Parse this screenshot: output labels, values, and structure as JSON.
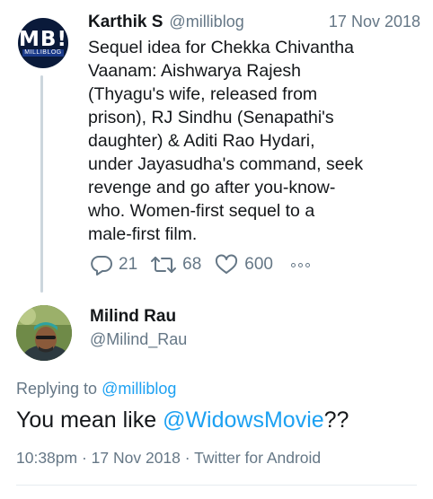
{
  "tweet1": {
    "avatar_text": "MB!",
    "avatar_subtext": "MILLIBLOG",
    "name": "Karthik S",
    "handle": "@milliblog",
    "date": "17 Nov 2018",
    "lines": [
      "Sequel idea for Chekka Chivantha",
      "Vaanam: Aishwarya Rajesh",
      "(Thyagu's wife, released from",
      "prison), RJ Sindhu (Senapathi's",
      "daughter) & Aditi Rao Hydari,",
      "under Jayasudha's command, seek",
      "revenge and go after you-know-",
      "who. Women-first sequel to a",
      "male-first film."
    ],
    "reply_count": "21",
    "retweet_count": "68",
    "like_count": "600",
    "icons": {
      "reply": "reply-icon",
      "retweet": "retweet-icon",
      "like": "heart-icon",
      "more": "more-dots-icon"
    }
  },
  "tweet2": {
    "name": "Milind Rau",
    "handle": "@Milind_Rau",
    "replying_prefix": "Replying to ",
    "replying_handle": "@milliblog",
    "text_prefix": "You mean like ",
    "text_mention": "@WidowsMovie",
    "text_suffix": "??",
    "meta": "10:38pm · 17 Nov 2018 · Twitter for Android"
  },
  "colors": {
    "text": "#14171a",
    "secondary": "#657786",
    "link": "#1da1f2",
    "thread_line": "#ccd6dd"
  }
}
